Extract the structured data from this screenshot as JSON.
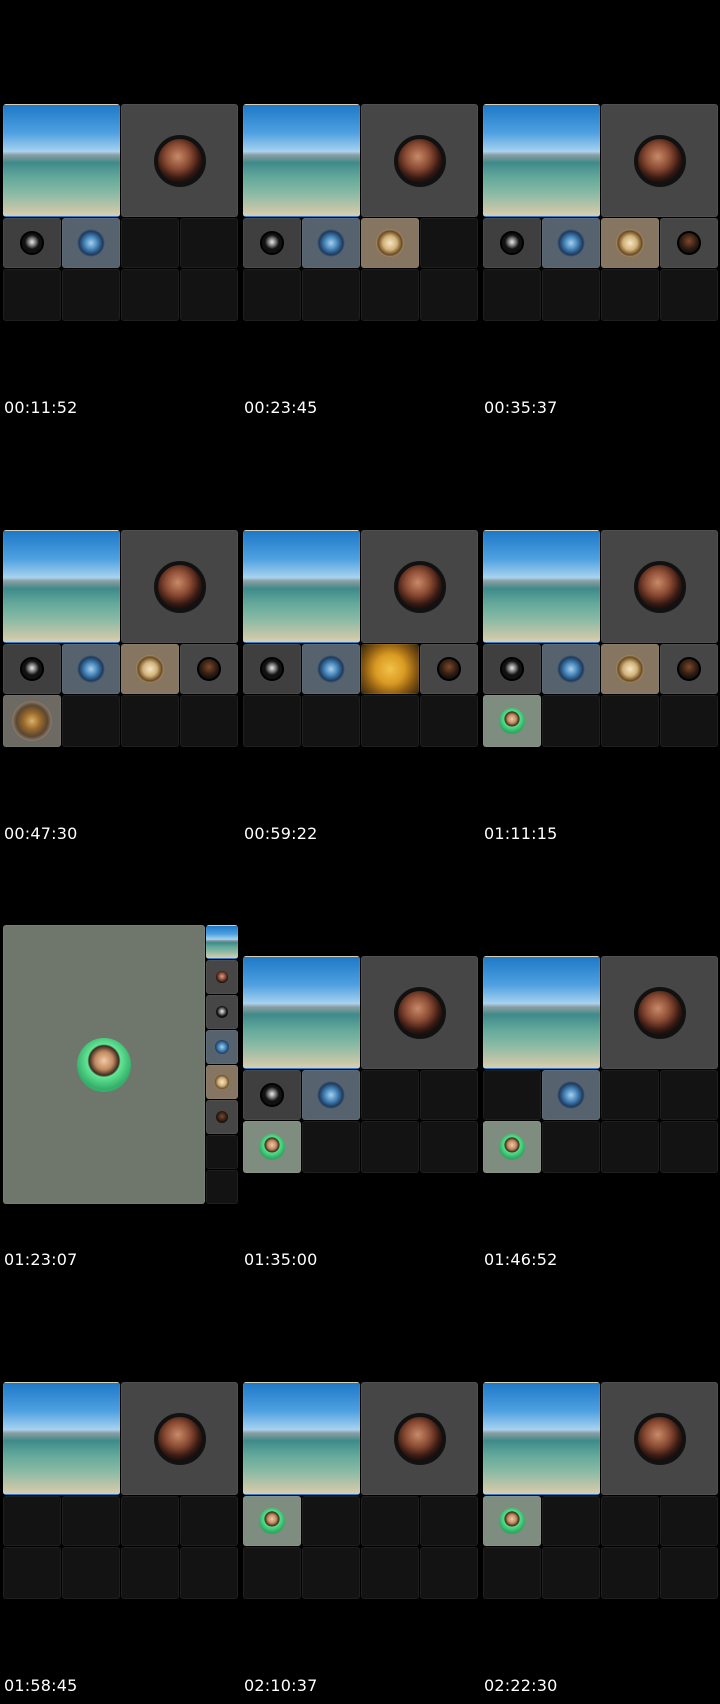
{
  "timestamps": [
    "00:11:52",
    "00:23:45",
    "00:35:37",
    "00:47:30",
    "00:59:22",
    "01:11:15",
    "01:23:07",
    "01:35:00",
    "01:46:52",
    "01:58:45",
    "02:10:37",
    "02:22:30"
  ],
  "icons": {
    "scene": "beach-scene-video",
    "woman": "woman-avatar-icon",
    "dark_woman": "dark-hair-woman-avatar-icon",
    "bw": "monochrome-avatar-icon",
    "dragon": "dragon-avatar-icon",
    "cookie": "cookie-avatar-icon",
    "tiger": "tiger-avatar-icon",
    "boy": "cartoon-boy-avatar-icon",
    "orange": "orange-fruit-video"
  },
  "colors": {
    "background": "#000000",
    "empty_tile": "#121312",
    "dark_tile": "#464646",
    "timestamp_text": "#ffffff"
  }
}
